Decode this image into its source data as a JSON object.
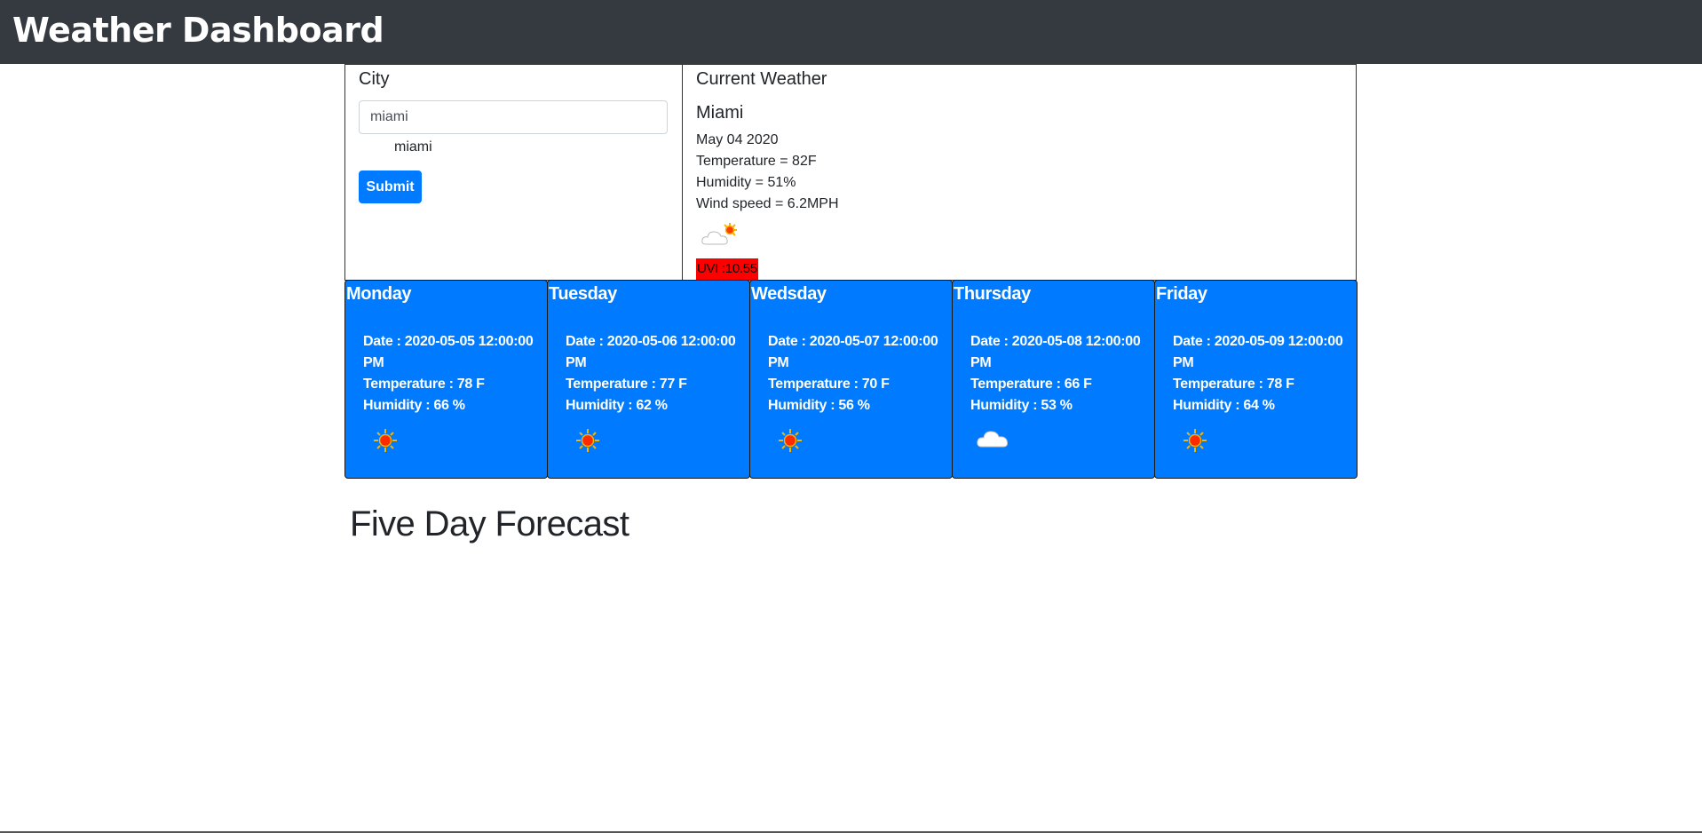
{
  "header": {
    "title": "Weather Dashboard"
  },
  "search": {
    "label": "City",
    "value": "miami",
    "history": [
      "miami"
    ],
    "submit_label": "Submit"
  },
  "current": {
    "title": "Current Weather",
    "city": "Miami",
    "date": "May 04 2020",
    "temperature": "Temperature = 82F",
    "humidity": "Humidity = 51%",
    "wind": "Wind speed = 6.2MPH",
    "icon": "cloud-sun-icon",
    "uvi": "UVI :10.55",
    "uvi_color": "#ff0000"
  },
  "forecast": [
    {
      "day": "Monday",
      "date": "Date : 2020-05-05 12:00:00 PM",
      "temp": "Temperature : 78 F",
      "humidity": "Humidity : 66 %",
      "icon": "sun-icon"
    },
    {
      "day": "Tuesday",
      "date": "Date : 2020-05-06 12:00:00 PM",
      "temp": "Temperature : 77 F",
      "humidity": "Humidity : 62 %",
      "icon": "sun-icon"
    },
    {
      "day": "Wedsday",
      "date": "Date : 2020-05-07 12:00:00 PM",
      "temp": "Temperature : 70 F",
      "humidity": "Humidity : 56 %",
      "icon": "sun-icon"
    },
    {
      "day": "Thursday",
      "date": "Date : 2020-05-08 12:00:00 PM",
      "temp": "Temperature : 66 F",
      "humidity": "Humidity : 53 %",
      "icon": "cloud-icon"
    },
    {
      "day": "Friday",
      "date": "Date : 2020-05-09 12:00:00 PM",
      "temp": "Temperature : 78 F",
      "humidity": "Humidity : 64 %",
      "icon": "sun-icon"
    }
  ],
  "forecast_title": "Five Day Forecast",
  "colors": {
    "navbar": "#343a40",
    "card": "#007bff",
    "button": "#007bff"
  }
}
